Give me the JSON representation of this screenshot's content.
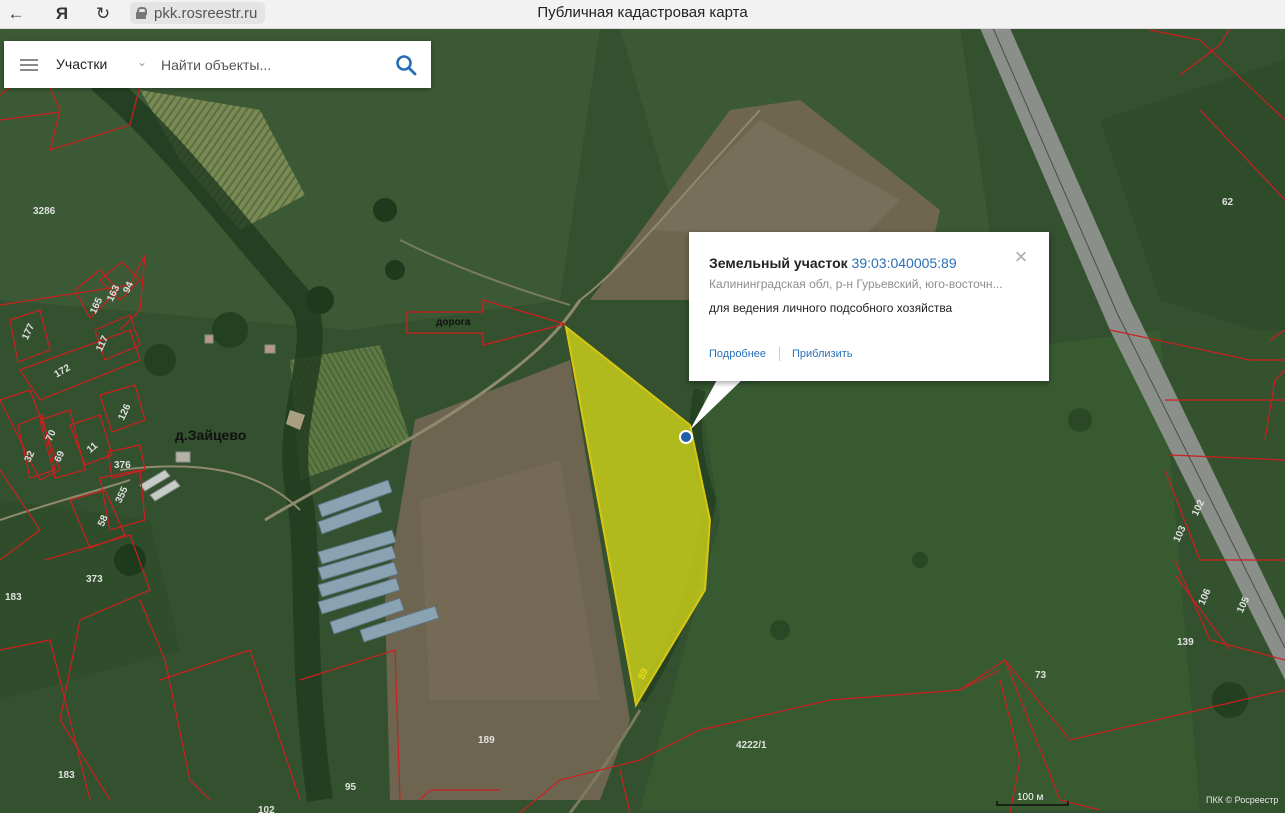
{
  "browser": {
    "back_icon": "arrow-left-icon",
    "yandex_label": "Я",
    "reload_icon": "reload-icon",
    "url": "pkk.rosreestr.ru",
    "title": "Публичная кадастровая карта"
  },
  "search": {
    "category": "Участки",
    "placeholder": "Найти объекты..."
  },
  "popup": {
    "type_label": "Земельный участок",
    "cadastral_number": "39:03:040005:89",
    "address": "Калининградская обл, р-н Гурьевский, юго-восточн...",
    "purpose": "для ведения личного подсобного хозяйства",
    "more_link": "Подробнее",
    "zoom_link": "Приблизить",
    "close": "×"
  },
  "map": {
    "village": "д.Зайцево",
    "road_label": "дорога",
    "selected_parcel_label": "89",
    "parcel_labels": [
      "3286",
      "165",
      "163",
      "94",
      "177",
      "117",
      "172",
      "70",
      "126",
      "32",
      "69",
      "11",
      "376",
      "355",
      "58",
      "373",
      "183",
      "183",
      "189",
      "95",
      "102",
      "62",
      "102",
      "103",
      "106",
      "105",
      "139",
      "73",
      "4222/1"
    ],
    "scale": "100 м",
    "attribution": "ПКК © Росреестр",
    "colors": {
      "parcel_border": "#cc1f1f",
      "selected_fill": "#c8cc1a",
      "accent": "#2a6fb5"
    }
  }
}
